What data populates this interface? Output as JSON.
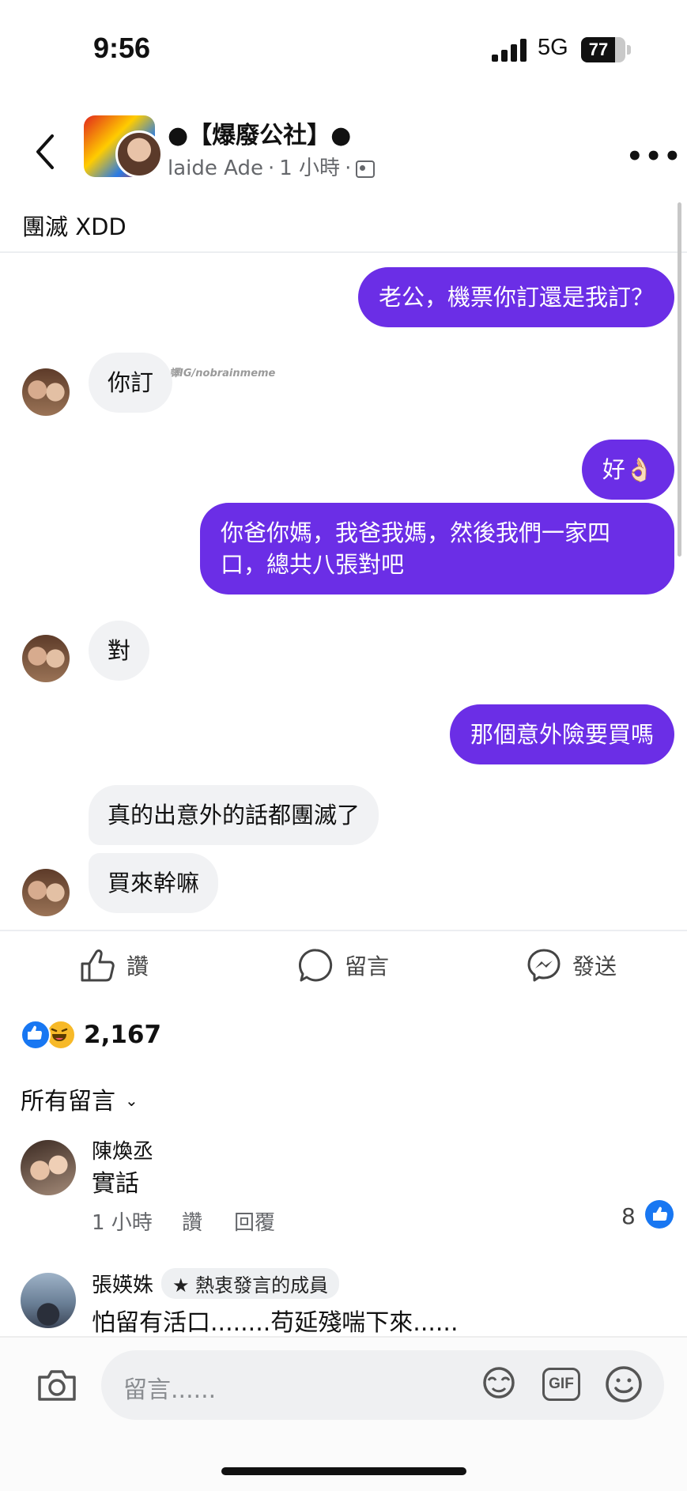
{
  "status_bar": {
    "time": "9:56",
    "network": "5G",
    "battery": "77",
    "battery_level": 0.77
  },
  "post": {
    "group_name": "●【爆廢公社】●",
    "author": "laide Ade",
    "sep": "·",
    "time": "1 小時",
    "caption": "團滅 XDD",
    "icons": {
      "back": "back-arrow-icon",
      "more": "more-options-icon",
      "audience": "photo-album-icon"
    }
  },
  "chat": {
    "watermark": "譯IG/nobrainmeme",
    "messages": [
      {
        "side": "out",
        "text": "老公，機票你訂還是我訂？"
      },
      {
        "side": "in",
        "text": "你訂"
      },
      {
        "side": "out",
        "text": "好👌🏻"
      },
      {
        "side": "out",
        "text": "你爸你媽，我爸我媽，然後我們一家四口，總共八張對吧"
      },
      {
        "side": "in",
        "text": "對"
      },
      {
        "side": "out",
        "text": "那個意外險要買嗎"
      },
      {
        "side": "in",
        "text": "真的出意外的話都團滅了"
      },
      {
        "side": "in",
        "text": "買來幹嘛"
      }
    ]
  },
  "actions": {
    "like": "讚",
    "comment": "留言",
    "send": "發送"
  },
  "reactions": {
    "count": "2,167",
    "icons": [
      "like-reaction-icon",
      "haha-reaction-icon"
    ]
  },
  "comments_filter": {
    "label": "所有留言"
  },
  "comments": [
    {
      "name": "陳煥丞",
      "text": "實話",
      "time": "1 小時",
      "like": "讚",
      "reply": "回覆",
      "likes": "8"
    },
    {
      "name": "張媖姝",
      "badge": "熱衷發言的成員",
      "text": "怕留有活口........苟延殘喘下來......"
    }
  ],
  "composer": {
    "placeholder": "留言......",
    "gif": "GIF"
  },
  "colors": {
    "outgoing_bubble": "#6b2ee6",
    "incoming_bubble": "#f1f2f4",
    "facebook_blue": "#1877f2"
  }
}
